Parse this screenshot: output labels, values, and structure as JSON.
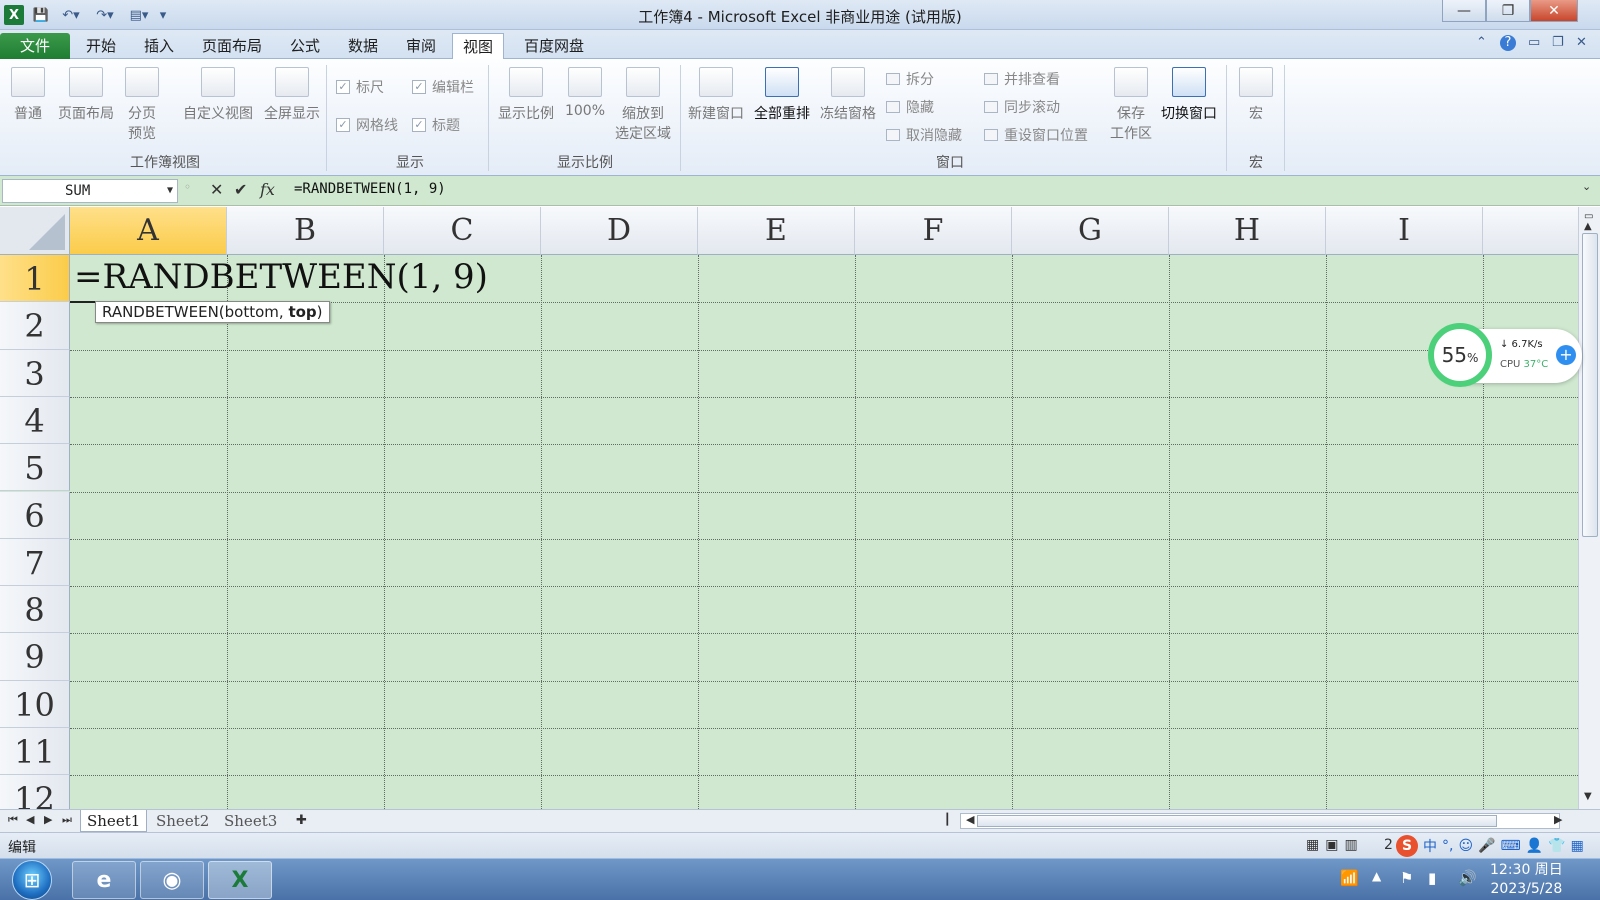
{
  "window": {
    "title": "工作簿4 - Microsoft Excel 非商业用途 (试用版)",
    "logo": "X",
    "min_label": "—",
    "max_label": "❐",
    "close_label": "✕"
  },
  "tabs": [
    "文件",
    "开始",
    "插入",
    "页面布局",
    "公式",
    "数据",
    "审阅",
    "视图",
    "百度网盘"
  ],
  "active_tab": "视图",
  "ribbon": {
    "workbook_views": {
      "label": "工作簿视图",
      "buttons": [
        "普通",
        "页面布局",
        "分页",
        "预览",
        "自定义视图",
        "全屏显示"
      ]
    },
    "show": {
      "label": "显示",
      "checks": [
        "标尺",
        "编辑栏",
        "网格线",
        "标题"
      ]
    },
    "zoom": {
      "label": "显示比例",
      "buttons": [
        "显示比例",
        "100%",
        "缩放到",
        "选定区域"
      ]
    },
    "window": {
      "label": "窗口",
      "buttons": [
        "新建窗口",
        "全部重排",
        "冻结窗格"
      ],
      "small": [
        "拆分",
        "隐藏",
        "取消隐藏",
        "并排查看",
        "同步滚动",
        "重设窗口位置"
      ],
      "save_workspace": [
        "保存",
        "工作区"
      ],
      "switch": "切换窗口"
    },
    "macros": {
      "label": "宏",
      "button": "宏"
    }
  },
  "formula_bar": {
    "name_box": "SUM",
    "fx": "fx",
    "formula": "=RANDBETWEEN(1, 9)"
  },
  "grid": {
    "columns": [
      "A",
      "B",
      "C",
      "D",
      "E",
      "F",
      "G",
      "H",
      "I"
    ],
    "rows": [
      "1",
      "2",
      "3",
      "4",
      "5",
      "6",
      "7",
      "8",
      "9",
      "10",
      "11",
      "12"
    ],
    "active_cell": "A1",
    "a1_text": "=RANDBETWEEN(1, 9)",
    "tooltip_prefix": "RANDBETWEEN(bottom, ",
    "tooltip_bold": "top",
    "tooltip_suffix": ")"
  },
  "widget": {
    "percent": "55",
    "percent_unit": "%",
    "net": "↓ 6.7K/s",
    "cpu_label": "CPU",
    "cpu_temp": "37°C"
  },
  "sheets": [
    "Sheet1",
    "Sheet2",
    "Sheet3"
  ],
  "active_sheet": "Sheet1",
  "status": {
    "mode": "编辑",
    "zoom_partial": "2"
  },
  "clock": {
    "time": "12:30 周日",
    "date": "2023/5/28"
  },
  "colors": {
    "sheet_bg": "#cfe8cf",
    "selected_header": "#fbcc4a",
    "file_tab": "#1f7d33"
  }
}
